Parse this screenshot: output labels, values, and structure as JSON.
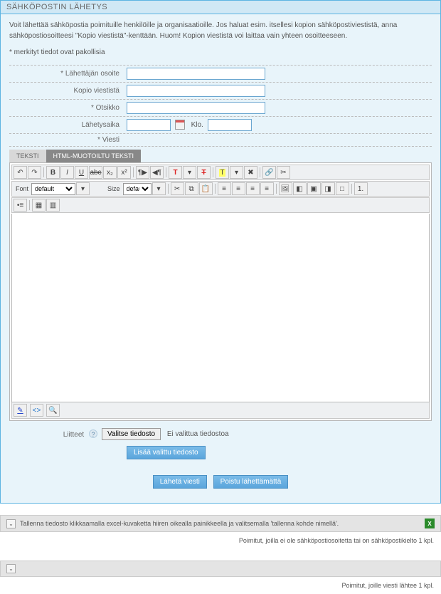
{
  "header": {
    "title": "SÄHKÖPOSTIN LÄHETYS"
  },
  "intro": "Voit lähettää sähköpostia poimituille henkilöille ja organisaatioille. Jos haluat esim. itsellesi kopion sähköpostiviestistä, anna sähköpostiosoitteesi \"Kopio viestistä\"-kenttään. Huom! Kopion viestistä voi laittaa vain yhteen osoitteeseen.",
  "required_note": "* merkityt tiedot ovat pakollisia",
  "form": {
    "sender_label": "* Lähettäjän osoite",
    "copy_label": "Kopio viestistä",
    "subject_label": "* Otsikko",
    "sendtime_label": "Lähetysaika",
    "klo_label": "Klo.",
    "message_label": "* Viesti"
  },
  "tabs": {
    "text": "TEKSTI",
    "html": "HTML-MUOTOILTU TEKSTI"
  },
  "toolbar": {
    "font_label": "Font",
    "font_value": "default",
    "size_label": "Size",
    "size_value": "defaul"
  },
  "attach": {
    "label": "Liitteet",
    "choose": "Valitse tiedosto",
    "none": "Ei valittua tiedostoa",
    "add": "Lisää valittu tiedosto"
  },
  "actions": {
    "send": "Lähetä viesti",
    "exit": "Poistu lähettämättä"
  },
  "info1": {
    "text": "Tallenna tiedosto klikkaamalla excel-kuvaketta hiiren oikealla painikkeella ja valitsemalla 'tallenna kohde nimellä'.",
    "count": "Poimitut, joilla ei ole sähköpostiosoitetta tai on sähköpostikielto 1 kpl."
  },
  "info2": {
    "count": "Poimitut, joille viesti lähtee 1 kpl."
  },
  "icons": {
    "excel": "X"
  }
}
